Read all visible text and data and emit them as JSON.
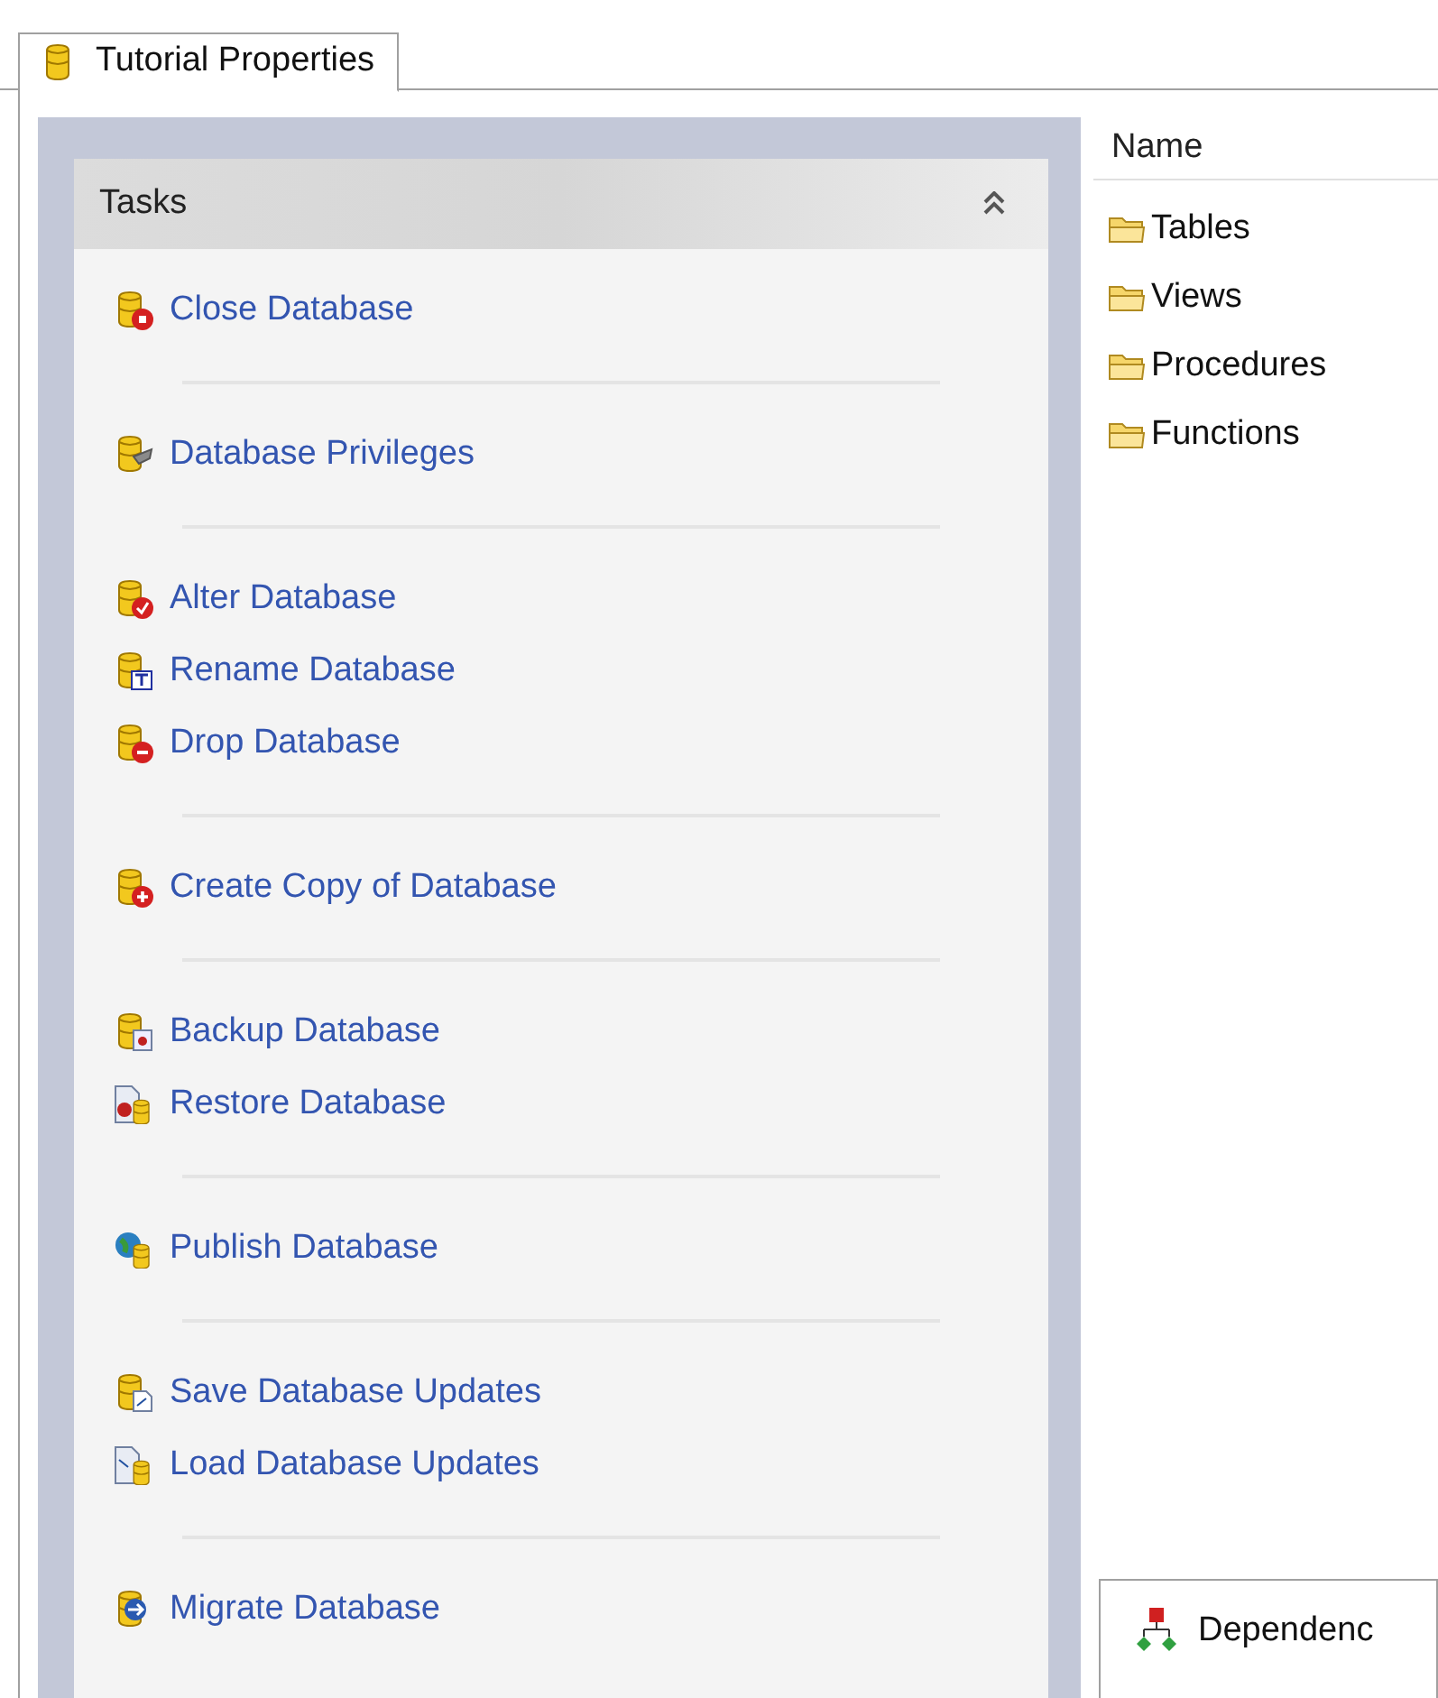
{
  "tab": {
    "label": "Tutorial Properties",
    "selected": true
  },
  "tasks": {
    "title": "Tasks",
    "expanded": true,
    "groups": [
      [
        {
          "label": "Close Database",
          "kind": "close"
        }
      ],
      [
        {
          "label": "Database Privileges",
          "kind": "privileges"
        }
      ],
      [
        {
          "label": "Alter Database",
          "kind": "alter"
        },
        {
          "label": "Rename Database",
          "kind": "rename"
        },
        {
          "label": "Drop Database",
          "kind": "drop"
        }
      ],
      [
        {
          "label": "Create Copy of Database",
          "kind": "copy"
        }
      ],
      [
        {
          "label": "Backup Database",
          "kind": "backup"
        },
        {
          "label": "Restore Database",
          "kind": "restore"
        }
      ],
      [
        {
          "label": "Publish Database",
          "kind": "publish"
        }
      ],
      [
        {
          "label": "Save Database Updates",
          "kind": "save"
        },
        {
          "label": "Load Database Updates",
          "kind": "load"
        }
      ],
      [
        {
          "label": "Migrate Database",
          "kind": "migrate"
        }
      ]
    ]
  },
  "list": {
    "column": "Name",
    "items": [
      {
        "label": "Tables"
      },
      {
        "label": "Views"
      },
      {
        "label": "Procedures"
      },
      {
        "label": "Functions"
      }
    ]
  },
  "bottom_tab": {
    "label": "Dependenc"
  }
}
